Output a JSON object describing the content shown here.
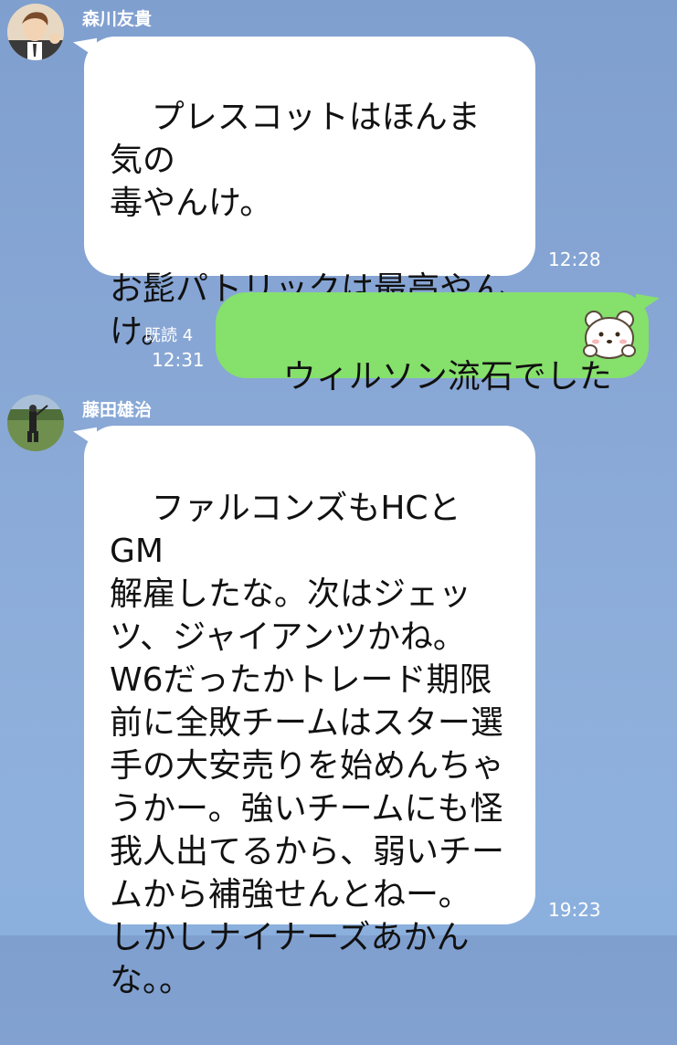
{
  "messages": [
    {
      "sender": "森川友貴",
      "text": "プレスコットはほんま気の\n毒やんけ。\n\nお髭パトリックは最高やん\nけ。",
      "time": "12:28"
    },
    {
      "read_label": "既読 4",
      "time": "12:31",
      "text": "ウィルソン流石でした",
      "sticker": "bear-emoji-icon"
    },
    {
      "sender": "藤田雄治",
      "text": "ファルコンズもHCとGM\n解雇したな。次はジェッ\nツ、ジャイアンツかね。\nW6だったかトレード期限\n前に全敗チームはスター選\n手の大安売りを始めんちゃ\nうかー。強いチームにも怪\n我人出てるから、弱いチー\nムから補強せんとねー。\nしかしナイナーズあかん\nな。。",
      "time": "19:23"
    }
  ],
  "colors": {
    "background": "#8aa8d6",
    "incoming_bubble": "#ffffff",
    "outgoing_bubble": "#86e06c"
  }
}
